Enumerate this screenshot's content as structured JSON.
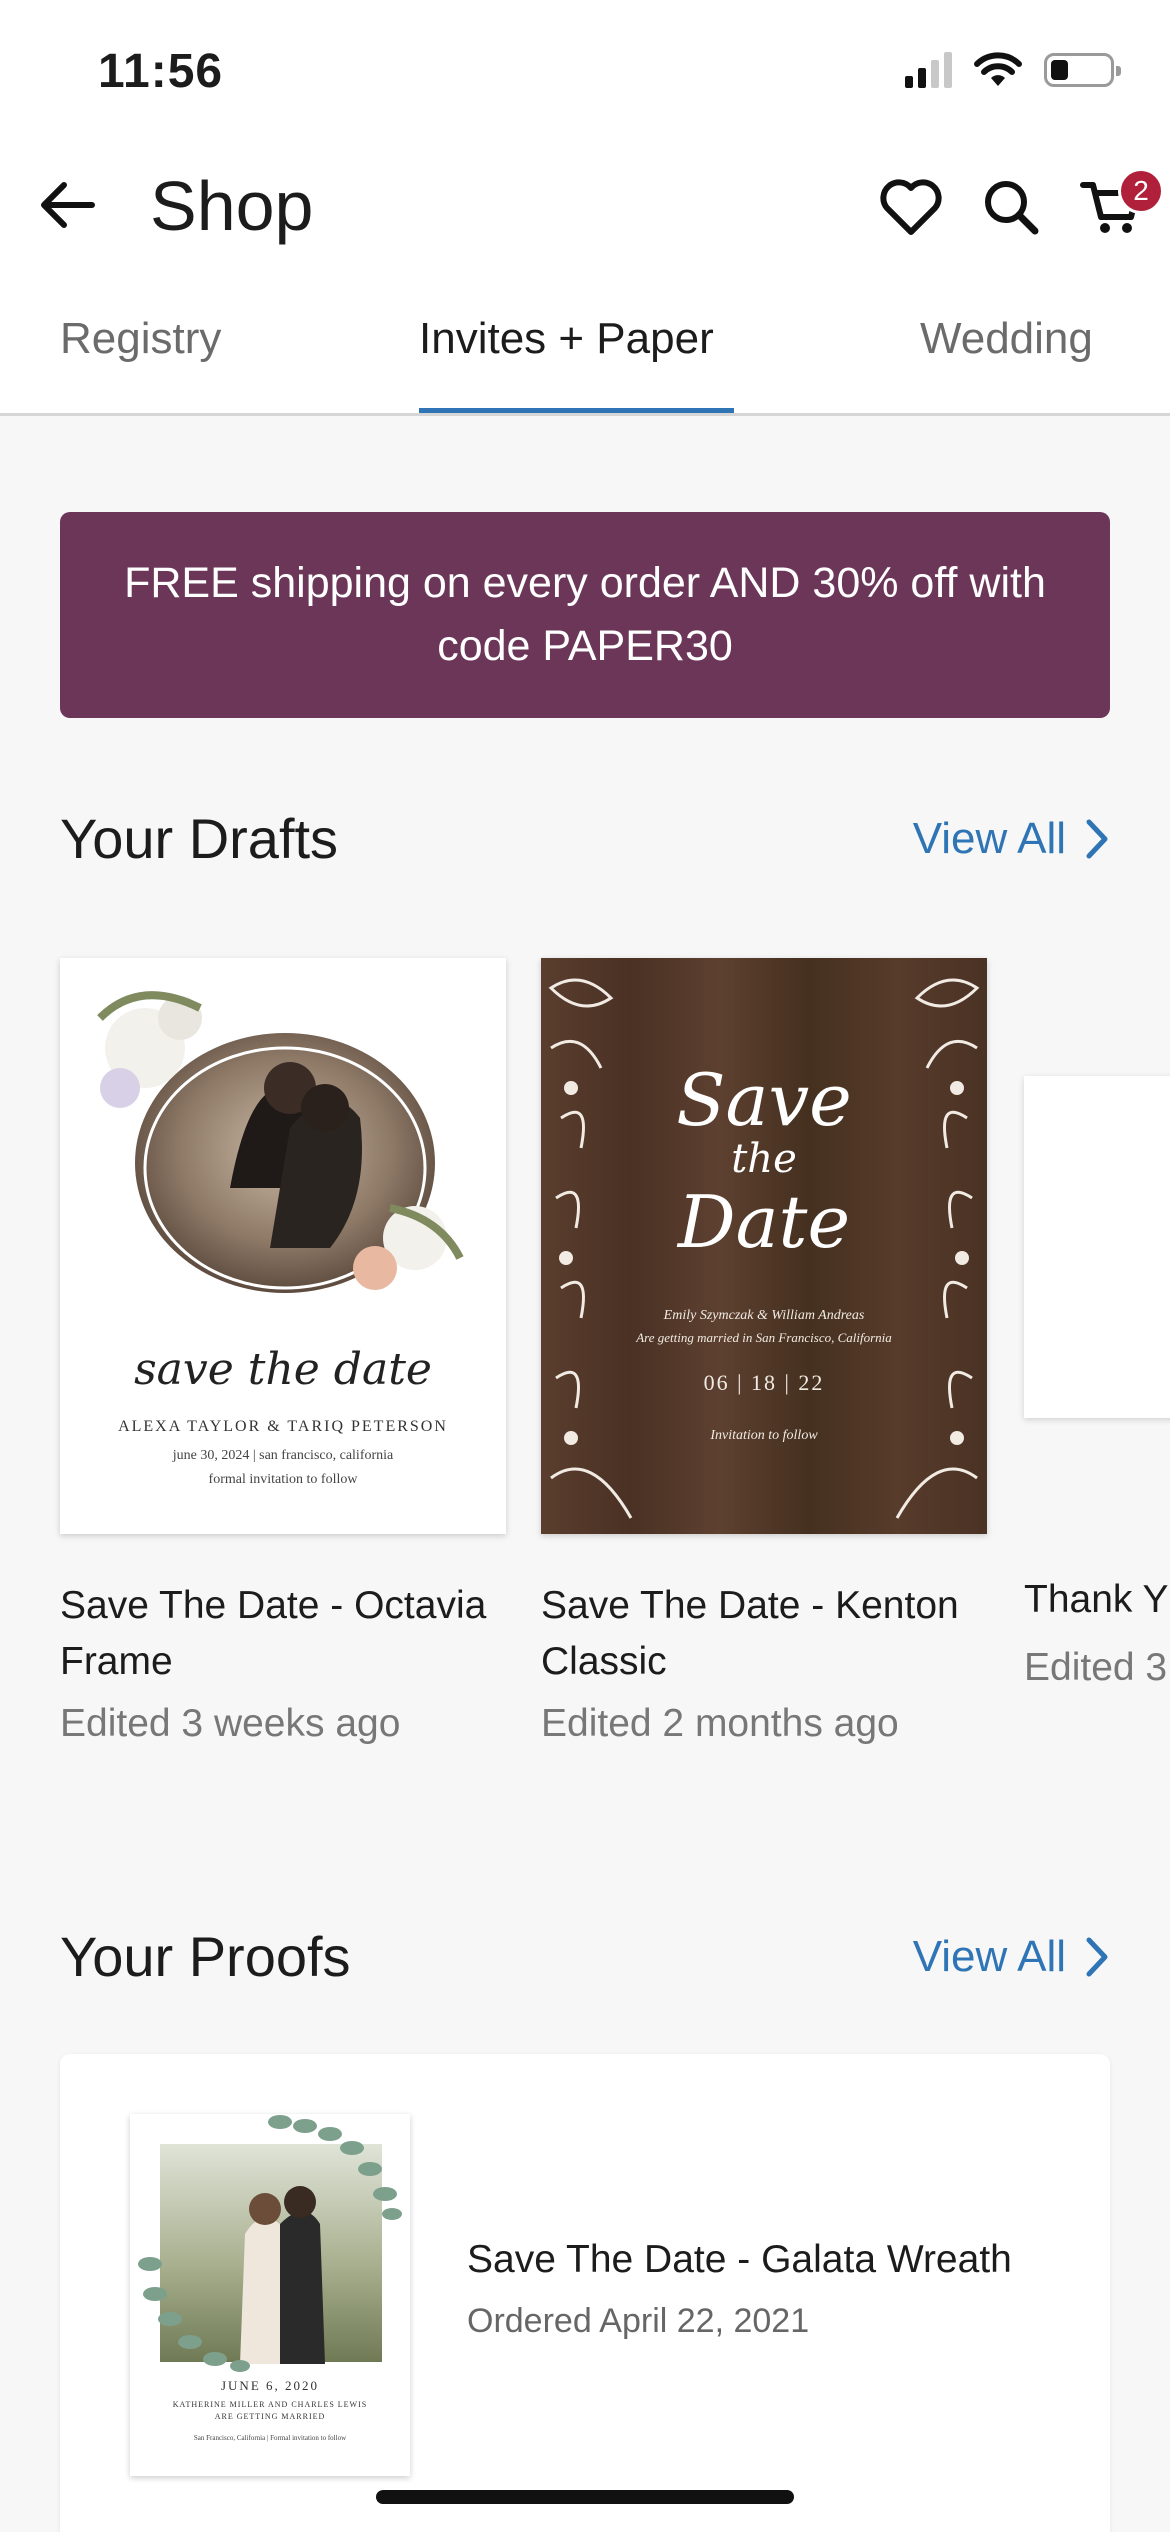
{
  "status_bar": {
    "time": "11:56",
    "battery_level": 0.3
  },
  "header": {
    "title": "Shop",
    "cart_count": "2"
  },
  "tabs": [
    {
      "label": "Registry"
    },
    {
      "label": "Invites + Paper"
    },
    {
      "label": "Wedding"
    }
  ],
  "promo": {
    "text": "FREE shipping on every order AND 30% off with code PAPER30"
  },
  "drafts": {
    "title": "Your Drafts",
    "view_all": "View All",
    "items": [
      {
        "name": "Save The Date - Octavia Frame",
        "meta": "Edited 3 weeks ago",
        "card_script": "save the date",
        "card_names": "ALEXA TAYLOR & TARIQ PETERSON",
        "card_line1": "june 30, 2024 | san francisco, california",
        "card_line2": "formal invitation to follow"
      },
      {
        "name": "Save The Date - Kenton Classic",
        "meta": "Edited 2 months ago",
        "card_script1": "Save",
        "card_script2": "the",
        "card_script3": "Date",
        "card_names": "Emily Szymczak & William Andreas",
        "card_line1": "Are getting married in San Francisco, California",
        "card_date": "06 | 18 | 22",
        "card_line2": "Invitation to follow"
      },
      {
        "name": "Thank Y",
        "meta": "Edited 3"
      }
    ]
  },
  "proofs": {
    "title": "Your Proofs",
    "view_all": "View All",
    "items": [
      {
        "name": "Save The Date - Galata Wreath",
        "date": "Ordered April 22, 2021",
        "card_date": "JUNE 6, 2020",
        "card_names": "KATHERINE MILLER AND CHARLES LEWIS",
        "card_line1": "ARE GETTING MARRIED",
        "card_line2": "San Francisco, California | Formal invitation to follow"
      }
    ]
  }
}
